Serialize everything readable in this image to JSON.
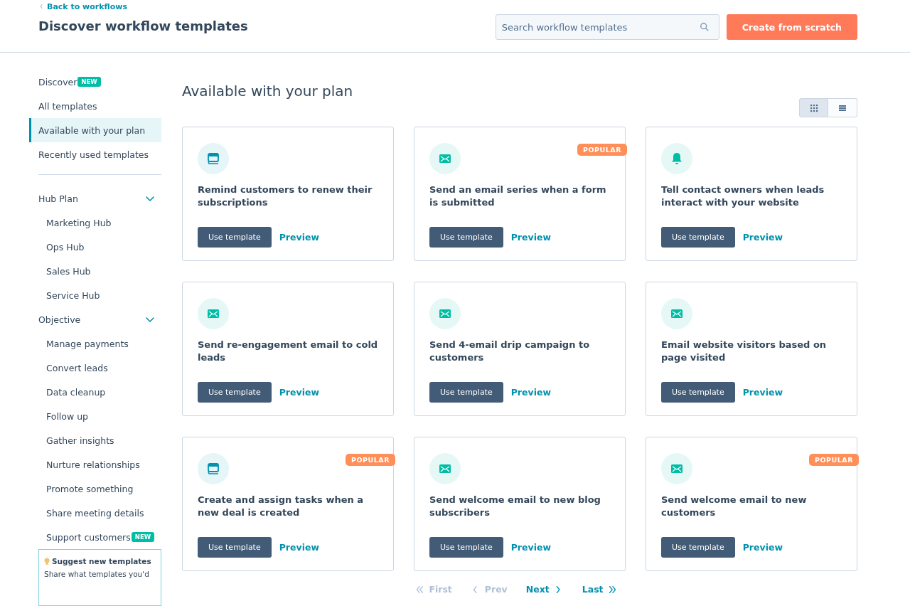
{
  "header": {
    "back_link": "Back to workflows",
    "title": "Discover workflow templates",
    "search": {
      "placeholder": "Search workflow templates"
    },
    "create_button": "Create from scratch"
  },
  "sidebar": {
    "items": [
      {
        "label": "Discover",
        "badge": "NEW",
        "selected": false
      },
      {
        "label": "All templates",
        "selected": false
      },
      {
        "label": "Available with your plan",
        "selected": true
      },
      {
        "label": "Recently used templates",
        "selected": false
      }
    ],
    "groups": [
      {
        "label": "Hub Plan",
        "expanded": true,
        "children": [
          {
            "label": "Marketing Hub"
          },
          {
            "label": "Ops Hub"
          },
          {
            "label": "Sales Hub"
          },
          {
            "label": "Service Hub"
          }
        ]
      },
      {
        "label": "Objective",
        "expanded": true,
        "children": [
          {
            "label": "Manage payments"
          },
          {
            "label": "Convert leads"
          },
          {
            "label": "Data cleanup"
          },
          {
            "label": "Follow up"
          },
          {
            "label": "Gather insights"
          },
          {
            "label": "Nurture relationships"
          },
          {
            "label": "Promote something"
          },
          {
            "label": "Share meeting details"
          },
          {
            "label": "Support customers",
            "badge": "NEW"
          }
        ]
      }
    ],
    "suggest": {
      "title": "Suggest new templates",
      "text": "Share what templates you'd"
    }
  },
  "main": {
    "heading": "Available with your plan",
    "view_toggle": [
      {
        "kind": "grid",
        "selected": true
      },
      {
        "kind": "list",
        "selected": false
      }
    ],
    "cards": [
      {
        "kind": "calendar",
        "title": "Remind customers to renew their subscriptions",
        "popular": false,
        "use": "Use template",
        "preview": "Preview"
      },
      {
        "kind": "email",
        "title": "Send an email series when a form is submitted",
        "popular": true,
        "badge": "POPULAR",
        "use": "Use template",
        "preview": "Preview"
      },
      {
        "kind": "bell",
        "title": "Tell contact owners when leads interact with your website",
        "popular": false,
        "use": "Use template",
        "preview": "Preview"
      },
      {
        "kind": "email",
        "title": "Send re-engagement email to cold leads",
        "popular": false,
        "use": "Use template",
        "preview": "Preview"
      },
      {
        "kind": "email",
        "title": "Send 4-email drip campaign to customers",
        "popular": false,
        "use": "Use template",
        "preview": "Preview"
      },
      {
        "kind": "email",
        "title": "Email website visitors based on page visited",
        "popular": false,
        "use": "Use template",
        "preview": "Preview"
      },
      {
        "kind": "calendar",
        "title": "Create and assign tasks when a new deal is created",
        "popular": true,
        "badge": "POPULAR",
        "use": "Use template",
        "preview": "Preview"
      },
      {
        "kind": "email",
        "title": "Send welcome email to new blog subscribers",
        "popular": false,
        "use": "Use template",
        "preview": "Preview"
      },
      {
        "kind": "email",
        "title": "Send welcome email to new customers",
        "popular": true,
        "badge": "POPULAR",
        "use": "Use template",
        "preview": "Preview"
      }
    ],
    "pagination": [
      {
        "kind": "first",
        "label": "First",
        "disabled": true
      },
      {
        "kind": "prev",
        "label": "Prev",
        "disabled": true
      },
      {
        "kind": "next",
        "label": "Next",
        "disabled": false
      },
      {
        "kind": "last",
        "label": "Last",
        "disabled": false
      }
    ]
  }
}
